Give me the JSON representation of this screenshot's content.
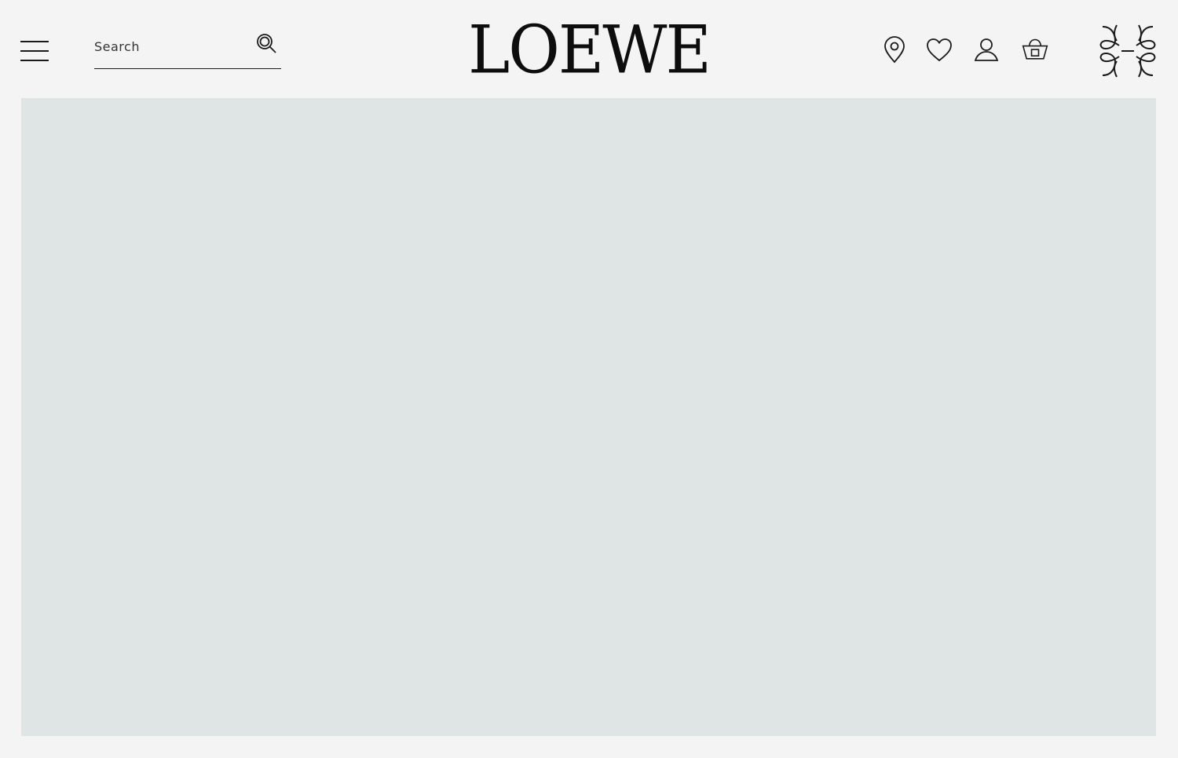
{
  "header": {
    "brand": "LOEWE",
    "search": {
      "placeholder": "Search",
      "value": ""
    },
    "icons": [
      "menu-icon",
      "search-icon",
      "location-pin-icon",
      "heart-icon",
      "user-icon",
      "basket-icon",
      "loewe-anagram-icon"
    ]
  },
  "hero": {
    "background_color": "#dfe4e4"
  },
  "colors": {
    "page_background": "#f4f4f4",
    "text": "#111111"
  }
}
